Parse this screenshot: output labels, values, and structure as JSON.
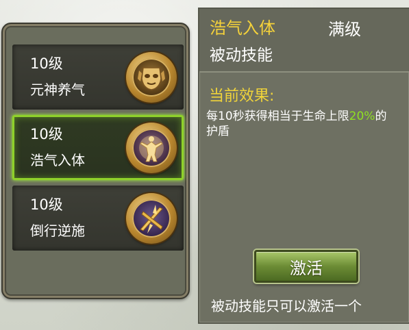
{
  "skills": [
    {
      "level": "10级",
      "name": "元神养气",
      "icon": "mask-emblem-icon",
      "selected": false
    },
    {
      "level": "10级",
      "name": "浩气入体",
      "icon": "glowing-figure-icon",
      "selected": true
    },
    {
      "level": "10级",
      "name": "倒行逆施",
      "icon": "crossed-blades-icon",
      "selected": false
    }
  ],
  "detail": {
    "title": "浩气入体",
    "grade": "满级",
    "type": "被动技能",
    "effect_heading": "当前效果:",
    "effect_text_before": "每10秒获得相当于生命上限",
    "effect_highlight": "20%",
    "effect_text_after": "的护盾",
    "activate_label": "激活",
    "footer_note": "被动技能只可以激活一个"
  },
  "colors": {
    "title": "#f5d23a",
    "highlight": "#8fe022",
    "selection_border": "#8fd12a",
    "button": "#6c8c35"
  }
}
